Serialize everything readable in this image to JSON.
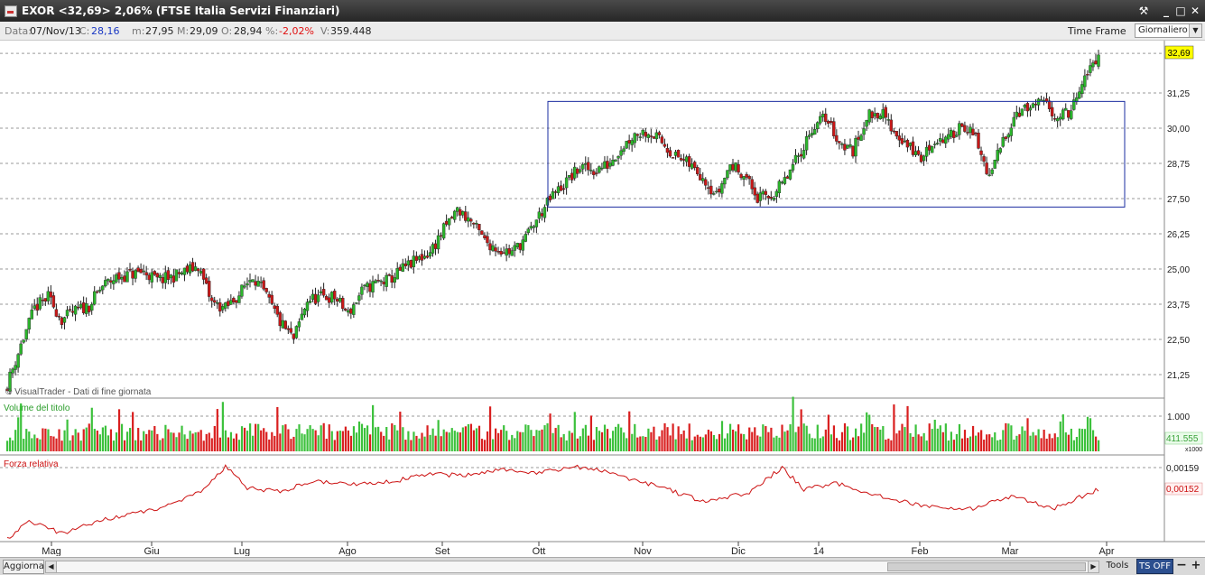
{
  "window": {
    "title": "EXOR <32,69> 2,06%  (FTSE Italia Servizi Finanziari)",
    "buttons": {
      "tools": "⚒",
      "minimize": "_",
      "maximize": "□",
      "close": "✕"
    }
  },
  "info": {
    "date_label": "Data:",
    "date": "07/Nov/13",
    "close_label": "C:",
    "close": "28,16",
    "min_label": "m:",
    "min": "27,95",
    "max_label": "M:",
    "max": "29,09",
    "open_label": "O:",
    "open": "28,94",
    "pct_label": "%:",
    "pct": "-2,02%",
    "vol_label": "V:",
    "vol": "359.448",
    "timeframe_label": "Time Frame",
    "timeframe_value": "Giornaliero"
  },
  "chart_data": [
    {
      "type": "candlestick",
      "name": "EXOR",
      "watermark": "© VisualTrader - Dati di fine giornata",
      "ylim": [
        20.5,
        33.25
      ],
      "y_ticks": [
        "31,25",
        "30,00",
        "28,75",
        "27,50",
        "26,25",
        "25,00",
        "23,75",
        "22,50",
        "21,25"
      ],
      "last_price": "32,69",
      "range_box": {
        "y_low": 27.2,
        "y_high": 30.95,
        "from": "Ott",
        "to": "Mar"
      },
      "x_labels": [
        "Mag",
        "Giu",
        "Lug",
        "Ago",
        "Set",
        "Ott",
        "Nov",
        "Dic",
        "14",
        "Feb",
        "Mar",
        "Apr"
      ],
      "series": [
        {
          "values": [
            20.9,
            22.3,
            23.6,
            24.0,
            23.2,
            23.5,
            23.7,
            24.4,
            24.7,
            24.8,
            24.9,
            24.6,
            24.7,
            24.9,
            25.1,
            23.8,
            23.6,
            24.1,
            24.8,
            24.0,
            23.1,
            22.5,
            23.9,
            24.0,
            24.0,
            23.4,
            24.2,
            24.5,
            24.6,
            25.0,
            25.3,
            25.6,
            26.4,
            27.1,
            26.7,
            26.0,
            25.7,
            25.6,
            26.1,
            26.9,
            27.6,
            28.1,
            28.6,
            28.5,
            28.7,
            29.3,
            29.8,
            29.9,
            29.5,
            29.0,
            28.7,
            28.3,
            27.6,
            28.7,
            28.4,
            27.5,
            27.6,
            28.1,
            29.0,
            30.0,
            30.4,
            29.5,
            29.2,
            30.4,
            30.6,
            29.9,
            29.4,
            28.9,
            29.6,
            29.6,
            30.2,
            29.6,
            28.2,
            29.6,
            30.6,
            30.7,
            30.9,
            30.4,
            30.6,
            31.7,
            32.69
          ]
        }
      ]
    },
    {
      "type": "bar",
      "name": "Volume del titolo",
      "unit": "x1000",
      "y_tick": "1.000",
      "last_value": "411.555",
      "values_k": []
    },
    {
      "type": "line",
      "name": "Forza relativa",
      "y_ticks": [
        "0,00159"
      ],
      "last_value": "0,00152",
      "values": []
    }
  ],
  "bottom": {
    "refresh": "Aggiorna",
    "tools": "Tools",
    "ts": "TS OFF",
    "minus": "−",
    "plus": "+"
  },
  "colors": {
    "up": "#2bb52b",
    "down": "#c81818",
    "volume_up": "#3cc13c",
    "volume_down": "#d91f1f",
    "rs_line": "#cc1111",
    "range_box": "#1a2ca0",
    "grid": "#9a9a9a",
    "last_price_bg": "#ffff00"
  }
}
